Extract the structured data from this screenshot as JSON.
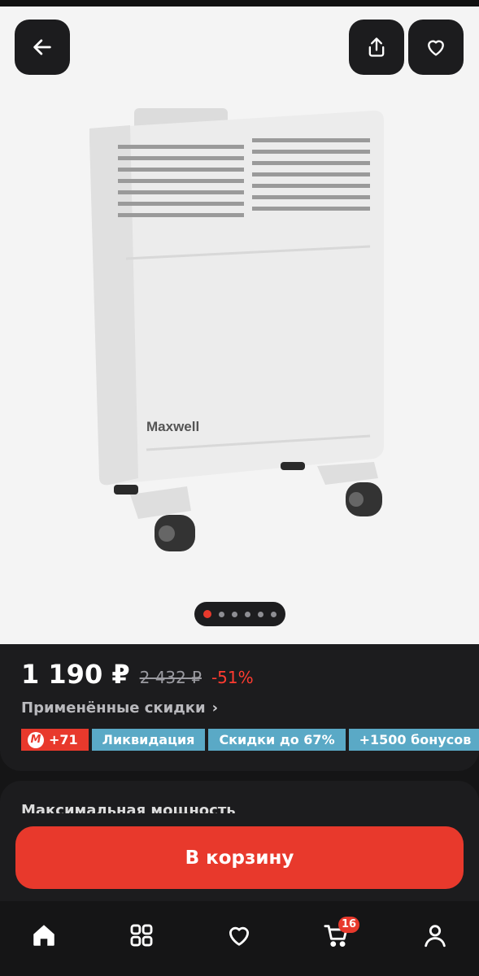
{
  "product": {
    "brand_text": "Maxwell",
    "price": "1 190 ₽",
    "old_price": "2 432 ₽",
    "discount": "-51%"
  },
  "discounts": {
    "applied_label": "Применённые скидки",
    "chevron": "›"
  },
  "badges": [
    {
      "label": "+71",
      "logo": "М",
      "color": "#e8392c"
    },
    {
      "label": "Ликвидация",
      "color": "#5aa9c6"
    },
    {
      "label": "Скидки до 67%",
      "color": "#5aa9c6"
    },
    {
      "label": "+1500 бонусов",
      "color": "#5aa9c6"
    }
  ],
  "gallery": {
    "image_count": 6,
    "active_index": 0
  },
  "info": {
    "title": "Максимальная мощность"
  },
  "cart_button": {
    "label": "В корзину"
  },
  "tabbar": {
    "items": [
      {
        "icon": "home-icon",
        "active": true
      },
      {
        "icon": "catalog-grid-icon",
        "active": false
      },
      {
        "icon": "heart-icon",
        "active": false
      },
      {
        "icon": "cart-icon",
        "active": false,
        "count": "16"
      },
      {
        "icon": "profile-icon",
        "active": false
      }
    ]
  },
  "colors": {
    "accent": "#e8392c",
    "badge_teal": "#5aa9c6",
    "background": "#151516",
    "card": "#1c1c1e"
  }
}
